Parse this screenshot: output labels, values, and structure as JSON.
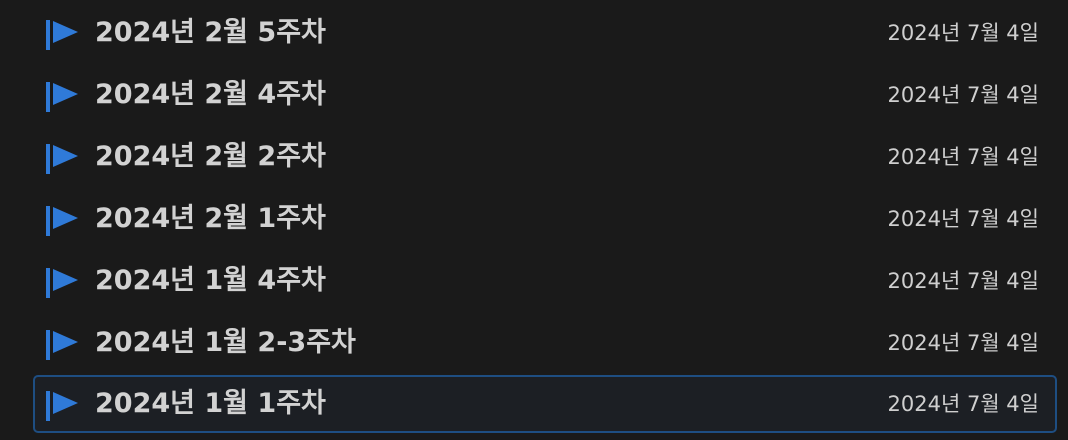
{
  "items": [
    {
      "title": "2024년 2월 5주차",
      "date": "2024년 7월 4일"
    },
    {
      "title": "2024년 2월 4주차",
      "date": "2024년 7월 4일"
    },
    {
      "title": "2024년 2월 2주차",
      "date": "2024년 7월 4일"
    },
    {
      "title": "2024년 2월 1주차",
      "date": "2024년 7월 4일"
    },
    {
      "title": "2024년 1월 4주차",
      "date": "2024년 7월 4일"
    },
    {
      "title": "2024년 1월 2-3주차",
      "date": "2024년 7월 4일"
    },
    {
      "title": "2024년 1월 1주차",
      "date": "2024년 7월 4일"
    }
  ],
  "selected_index": 6,
  "icon": "flag-icon",
  "colors": {
    "background": "#1a1a1a",
    "accent": "#2f7ad8",
    "selected_border": "#1e4e82",
    "text": "#d2d2d2"
  }
}
